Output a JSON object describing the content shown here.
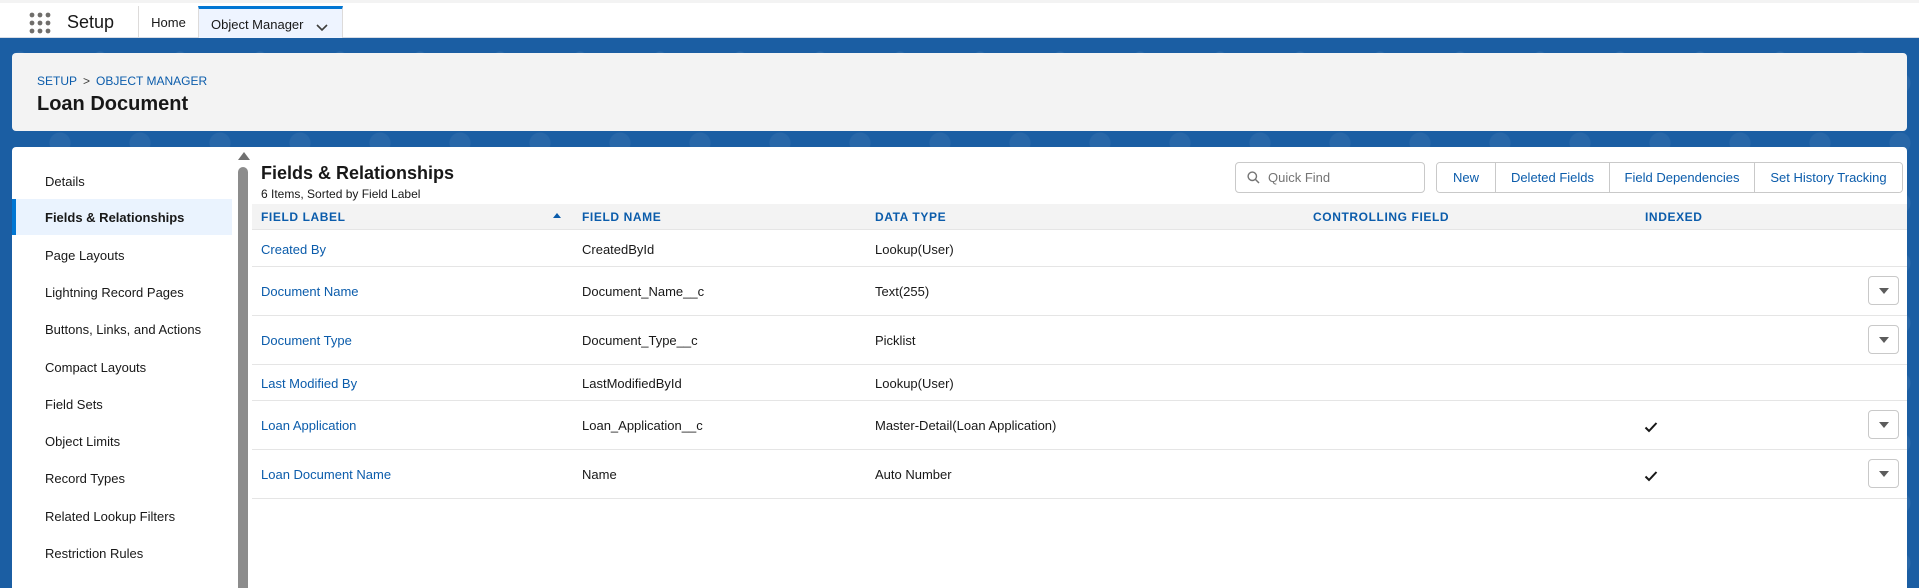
{
  "nav": {
    "app_name": "Setup",
    "tabs": [
      {
        "label": "Home"
      },
      {
        "label": "Object Manager"
      }
    ]
  },
  "header": {
    "breadcrumb": [
      "SETUP",
      "OBJECT MANAGER"
    ],
    "breadcrumb_separator": ">",
    "title": "Loan Document"
  },
  "sidebar": {
    "items": [
      {
        "label": "Details"
      },
      {
        "label": "Fields & Relationships",
        "active": true
      },
      {
        "label": "Page Layouts"
      },
      {
        "label": "Lightning Record Pages"
      },
      {
        "label": "Buttons, Links, and Actions"
      },
      {
        "label": "Compact Layouts"
      },
      {
        "label": "Field Sets"
      },
      {
        "label": "Object Limits"
      },
      {
        "label": "Record Types"
      },
      {
        "label": "Related Lookup Filters"
      },
      {
        "label": "Restriction Rules"
      }
    ]
  },
  "content": {
    "title": "Fields & Relationships",
    "subtitle": "6 Items, Sorted by Field Label",
    "search": {
      "placeholder": "Quick Find",
      "value": ""
    },
    "buttons": [
      {
        "label": "New"
      },
      {
        "label": "Deleted Fields"
      },
      {
        "label": "Field Dependencies"
      },
      {
        "label": "Set History Tracking"
      }
    ],
    "columns": [
      "FIELD LABEL",
      "FIELD NAME",
      "DATA TYPE",
      "CONTROLLING FIELD",
      "INDEXED"
    ],
    "sort_column": "FIELD LABEL",
    "sort_direction": "ascending",
    "rows": [
      {
        "label": "Created By",
        "name": "CreatedById",
        "type": "Lookup(User)",
        "controlling": "",
        "indexed": false,
        "menu": false
      },
      {
        "label": "Document Name",
        "name": "Document_Name__c",
        "type": "Text(255)",
        "controlling": "",
        "indexed": false,
        "menu": true
      },
      {
        "label": "Document Type",
        "name": "Document_Type__c",
        "type": "Picklist",
        "controlling": "",
        "indexed": false,
        "menu": true
      },
      {
        "label": "Last Modified By",
        "name": "LastModifiedById",
        "type": "Lookup(User)",
        "controlling": "",
        "indexed": false,
        "menu": false
      },
      {
        "label": "Loan Application",
        "name": "Loan_Application__c",
        "type": "Master-Detail(Loan Application)",
        "controlling": "",
        "indexed": true,
        "menu": true
      },
      {
        "label": "Loan Document Name",
        "name": "Name",
        "type": "Auto Number",
        "controlling": "",
        "indexed": true,
        "menu": true
      }
    ]
  },
  "colors": {
    "brand": "#0176d3",
    "link": "#0b5cab",
    "banner": "#1b5ea3"
  }
}
